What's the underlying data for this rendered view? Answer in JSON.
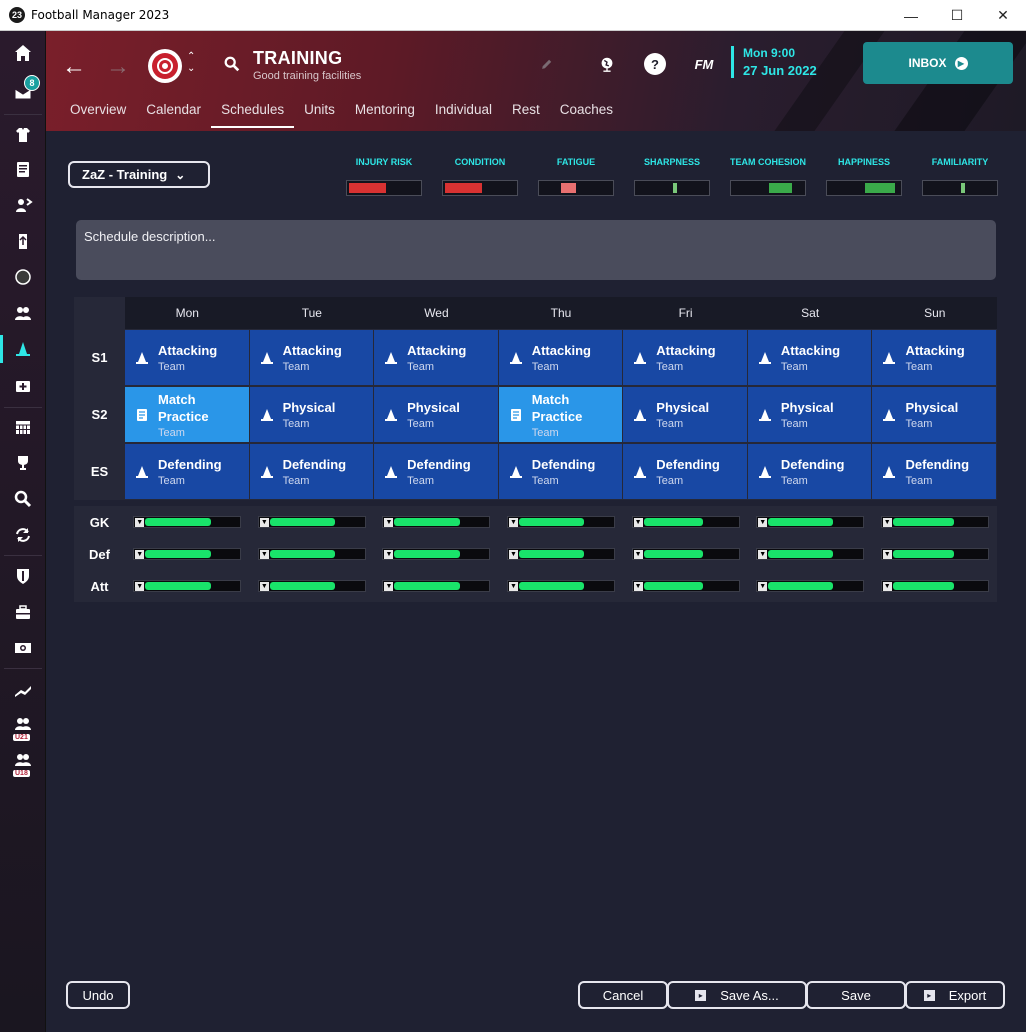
{
  "window": {
    "title": "Football Manager 2023",
    "app_icon_text": "23",
    "controls": [
      "—",
      "☐",
      "✕"
    ]
  },
  "sidebar": {
    "inbox_badge": "8",
    "u21_label": "U21",
    "u18_label": "U18"
  },
  "header": {
    "title": "TRAINING",
    "subtitle": "Good training facilities",
    "fm_label": "FM",
    "date_day": "Mon 9:00",
    "date_date": "27 Jun 2022",
    "inbox_label": "INBOX",
    "tabs": [
      "Overview",
      "Calendar",
      "Schedules",
      "Units",
      "Mentoring",
      "Individual",
      "Rest",
      "Coaches"
    ],
    "active_tab": "Schedules"
  },
  "schedule": {
    "selected": "ZaZ - Training",
    "description_placeholder": "Schedule description..."
  },
  "meters": [
    {
      "label": "INJURY RISK",
      "color": "#d83232",
      "start": 0.0,
      "width": 0.52
    },
    {
      "label": "CONDITION",
      "color": "#d83232",
      "start": 0.0,
      "width": 0.52
    },
    {
      "label": "FATIGUE",
      "color": "#e87070",
      "start": 0.28,
      "width": 0.2
    },
    {
      "label": "SHARPNESS",
      "color": "#7ac87a",
      "start": 0.5,
      "width": 0.05
    },
    {
      "label": "TEAM COHESION",
      "color": "#3aaa4a",
      "start": 0.5,
      "width": 0.32
    },
    {
      "label": "HAPPINESS",
      "color": "#3aaa4a",
      "start": 0.5,
      "width": 0.42
    },
    {
      "label": "FAMILIARITY",
      "color": "#7ac87a",
      "start": 0.5,
      "width": 0.05
    }
  ],
  "days": [
    "Mon",
    "Tue",
    "Wed",
    "Thu",
    "Fri",
    "Sat",
    "Sun"
  ],
  "sessions": [
    {
      "label": "S1",
      "cells": [
        {
          "title": "Attacking",
          "sub": "Team",
          "type": "cone"
        },
        {
          "title": "Attacking",
          "sub": "Team",
          "type": "cone"
        },
        {
          "title": "Attacking",
          "sub": "Team",
          "type": "cone"
        },
        {
          "title": "Attacking",
          "sub": "Team",
          "type": "cone"
        },
        {
          "title": "Attacking",
          "sub": "Team",
          "type": "cone"
        },
        {
          "title": "Attacking",
          "sub": "Team",
          "type": "cone"
        },
        {
          "title": "Attacking",
          "sub": "Team",
          "type": "cone"
        }
      ]
    },
    {
      "label": "S2",
      "cells": [
        {
          "title": "Match Practice",
          "sub": "Team",
          "type": "match"
        },
        {
          "title": "Physical",
          "sub": "Team",
          "type": "cone"
        },
        {
          "title": "Physical",
          "sub": "Team",
          "type": "cone"
        },
        {
          "title": "Match Practice",
          "sub": "Team",
          "type": "match"
        },
        {
          "title": "Physical",
          "sub": "Team",
          "type": "cone"
        },
        {
          "title": "Physical",
          "sub": "Team",
          "type": "cone"
        },
        {
          "title": "Physical",
          "sub": "Team",
          "type": "cone"
        }
      ]
    },
    {
      "label": "ES",
      "cells": [
        {
          "title": "Defending",
          "sub": "Team",
          "type": "cone"
        },
        {
          "title": "Defending",
          "sub": "Team",
          "type": "cone"
        },
        {
          "title": "Defending",
          "sub": "Team",
          "type": "cone"
        },
        {
          "title": "Defending",
          "sub": "Team",
          "type": "cone"
        },
        {
          "title": "Defending",
          "sub": "Team",
          "type": "cone"
        },
        {
          "title": "Defending",
          "sub": "Team",
          "type": "cone"
        },
        {
          "title": "Defending",
          "sub": "Team",
          "type": "cone"
        }
      ]
    }
  ],
  "performance": [
    {
      "label": "GK",
      "values": [
        0.68,
        0.68,
        0.68,
        0.68,
        0.62,
        0.68,
        0.64
      ]
    },
    {
      "label": "Def",
      "values": [
        0.68,
        0.68,
        0.68,
        0.68,
        0.62,
        0.68,
        0.64
      ]
    },
    {
      "label": "Att",
      "values": [
        0.68,
        0.68,
        0.68,
        0.68,
        0.62,
        0.68,
        0.64
      ]
    }
  ],
  "buttons": {
    "undo": "Undo",
    "cancel": "Cancel",
    "save_as": "Save As...",
    "save": "Save",
    "export": "Export"
  }
}
